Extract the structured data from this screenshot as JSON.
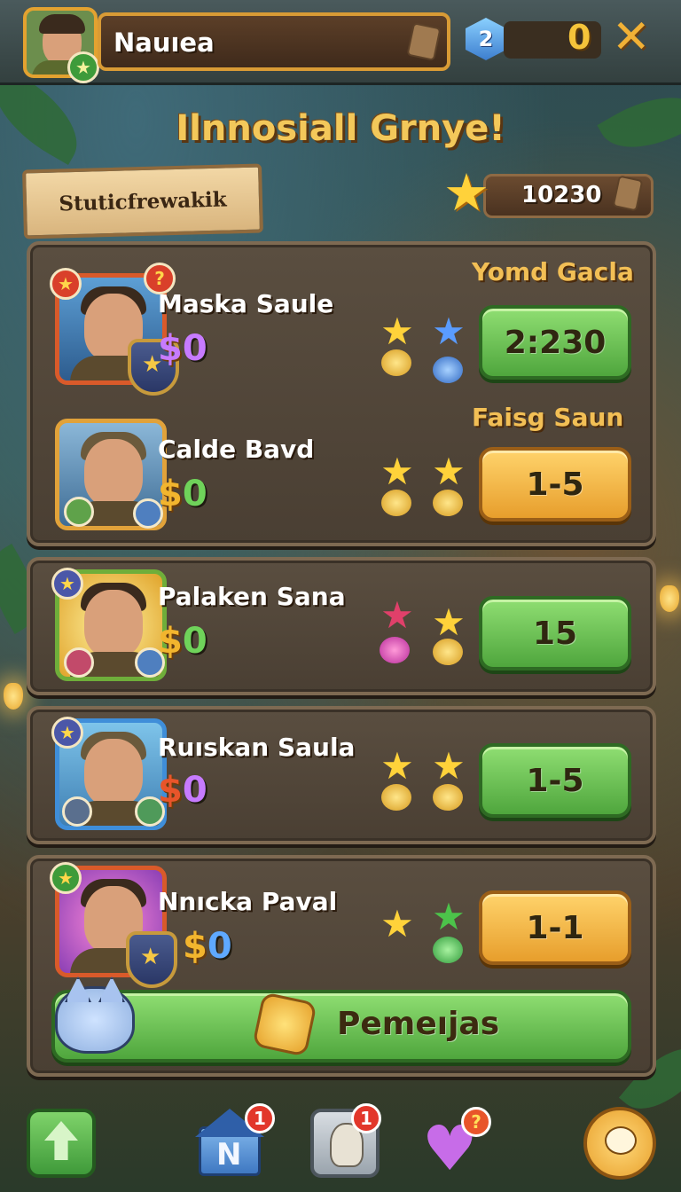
{
  "player": {
    "name": "Nauıea",
    "gem_level": "2",
    "gem_count": "0",
    "close_symbol": "✕"
  },
  "title": "Ilnnosiall Grnye!",
  "sign": "Stuticfrewakik",
  "score": {
    "value": "10230"
  },
  "heroes": [
    {
      "name": "Maska Saule",
      "currency": "$",
      "cost": "0",
      "cost_color": "#c77bff",
      "header": "Yomd Gacla",
      "button": "2:230",
      "button_style": "green",
      "rewards": [
        "gold-star-icon",
        "blue-star-icon"
      ],
      "frame_color": "#d95a2a"
    },
    {
      "name": "Calde Bavd",
      "currency": "$",
      "cost": "0",
      "cost_color": "#6fd35a",
      "header": "Faisg Saun",
      "button": "1-5",
      "button_style": "orange",
      "rewards": [
        "gold-star-icon",
        "gold-star-icon"
      ],
      "frame_color": "#e1a23a"
    },
    {
      "name": "Palaken Sana",
      "currency": "$",
      "cost": "0",
      "cost_color": "#6fd35a",
      "header": "",
      "button": "15",
      "button_style": "green",
      "rewards": [
        "pink-star-icon",
        "gold-star-icon"
      ],
      "frame_color": "#6fae3a"
    },
    {
      "name": "Ruıskan Saula",
      "currency": "$",
      "cost": "0",
      "cost_color": "#c77bff",
      "header": "",
      "button": "1-5",
      "button_style": "green",
      "rewards": [
        "gold-star-icon",
        "gold-star-icon"
      ],
      "frame_color": "#3f8ed9"
    },
    {
      "name": "Nnıcka Paval",
      "currency": "$",
      "cost": "0",
      "cost_color": "#5fa9ff",
      "header": "",
      "button": "1-1",
      "button_style": "orange",
      "rewards": [
        "gold-star-icon",
        "green-star-icon"
      ],
      "frame_color": "#d95a2a"
    }
  ],
  "claim_button": {
    "label": "Pemeıjas"
  },
  "bottom_nav": [
    {
      "icon": "upgrade-arrow-icon",
      "badge": ""
    },
    {
      "icon": "house-n-icon",
      "badge": "1"
    },
    {
      "icon": "pet-icon",
      "badge": "1"
    },
    {
      "icon": "heart-icon",
      "badge": "?"
    },
    {
      "icon": "chat-bubble-icon",
      "badge": ""
    }
  ],
  "colors": {
    "gold": "#f5c43a",
    "wood": "#5a4e40",
    "green_button": "#4fa63d",
    "orange_button": "#e79e2c"
  }
}
